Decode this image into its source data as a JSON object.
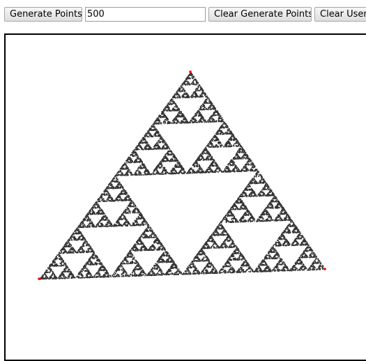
{
  "toolbar": {
    "generate_label": "Generate Points",
    "count_value": "500",
    "clear_generated_label": "Clear Generate Points",
    "clear_user_label": "Clear User"
  },
  "canvas": {
    "point_color": "#333333",
    "vertex_color": "#ff0000",
    "generated_point_count": 500
  }
}
